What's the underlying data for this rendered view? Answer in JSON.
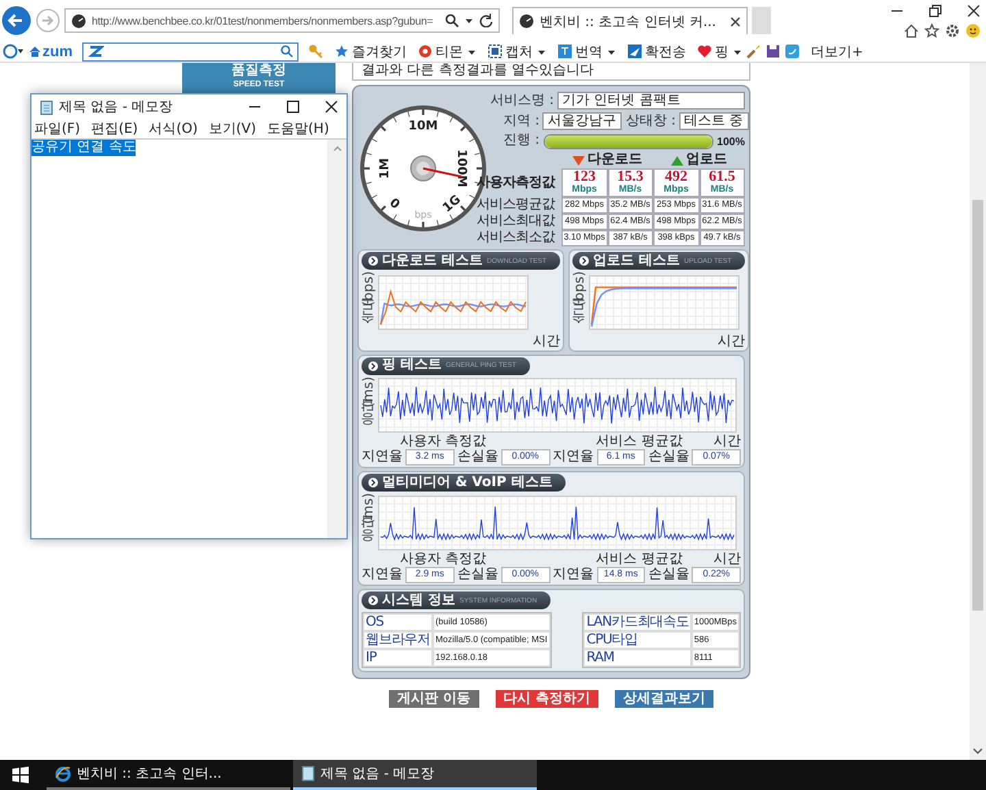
{
  "browser": {
    "url": "http://www.benchbee.co.kr/01test/nonmembers/nonmembers.asp?gubun=",
    "tab_title": "벤치비 :: 초고속 인터넷 커...",
    "toolbar": {
      "logo": "zum",
      "items": [
        {
          "kind": "star",
          "label": "즐겨찾기",
          "caret": false
        },
        {
          "kind": "dot",
          "label": "티몬",
          "caret": true
        },
        {
          "kind": "capture",
          "label": "캡처",
          "caret": true
        },
        {
          "kind": "translate",
          "label": "번역",
          "caret": true
        },
        {
          "kind": "send",
          "label": "확전송",
          "caret": false
        },
        {
          "kind": "heart",
          "label": "핑",
          "caret": true
        },
        {
          "kind": "tools",
          "label": "더보기+",
          "caret": false
        }
      ]
    }
  },
  "banner": {
    "title": "품질측정",
    "subtitle": "SPEED TEST"
  },
  "notice": "결과와 다른 측정결과를 열수있습니다",
  "gauge": {
    "labels": [
      "0",
      "1M",
      "10M",
      "100M",
      "1G"
    ],
    "unit": "bps"
  },
  "info": {
    "service": {
      "label": "서비스명 :",
      "value": "기가 인터넷 콤팩트"
    },
    "region": {
      "label": "지역 :",
      "value": "서울강남구"
    },
    "status": {
      "label": "상태창 :",
      "value": "테스트 중"
    },
    "progress": {
      "label": "진행 :",
      "level": 1,
      "reading": "100%"
    }
  },
  "results": {
    "groups": [
      {
        "kind": "download",
        "label": "다운로드"
      },
      {
        "kind": "upload",
        "label": "업로드"
      }
    ],
    "rows": [
      {
        "kind": "main",
        "label": "사용자측정값",
        "cells": [
          {
            "value": "123",
            "unit": "Mbps"
          },
          {
            "value": "15.3",
            "unit": "MB/s"
          },
          {
            "value": "492",
            "unit": "Mbps"
          },
          {
            "value": "61.5",
            "unit": "MB/s"
          }
        ]
      },
      {
        "kind": "plain",
        "label": "서비스평균값",
        "cells": [
          "282 Mbps",
          "35.2 MB/s",
          "253 Mbps",
          "31.6 MB/s"
        ]
      },
      {
        "kind": "plain",
        "label": "서비스최대값",
        "cells": [
          "498 Mbps",
          "62.4 MB/s",
          "498 Mbps",
          "62.2 MB/s"
        ]
      },
      {
        "kind": "plain",
        "label": "서비스최소값",
        "cells": [
          "3.10 Mbps",
          "387 kB/s",
          "398 kBps",
          "49.7 kB/s"
        ]
      }
    ]
  },
  "throughput": [
    {
      "kind": "download",
      "title": "다운로드 테스트",
      "subtitle": "DOWNLOAD TEST",
      "ylabel": "속도(bps)",
      "xlabel": "시간"
    },
    {
      "kind": "upload",
      "title": "업로드 테스트",
      "subtitle": "UPLOAD TEST",
      "ylabel": "속도(bps)",
      "xlabel": "시간"
    }
  ],
  "latency": [
    {
      "kind": "ping",
      "title": "핑 테스트",
      "subtitle": "GENERAL PING TEST",
      "ylabel": "응답(ms)",
      "xlabel": "시간",
      "user_label": "사용자 측정값",
      "service_label": "서비스 평균값",
      "stats": [
        {
          "label": "지연율",
          "value": "3.2 ms"
        },
        {
          "label": "손실율",
          "value": "0.00%"
        },
        {
          "label": "지연율",
          "value": "6.1 ms"
        },
        {
          "label": "손실율",
          "value": "0.07%"
        }
      ]
    },
    {
      "kind": "voip",
      "title": "멀티미디어 & VoIP 테스트",
      "ylabel": "응답(ms)",
      "xlabel": "시간",
      "user_label": "사용자 측정값",
      "service_label": "서비스 평균값",
      "stats": [
        {
          "label": "지연율",
          "value": "2.9 ms"
        },
        {
          "label": "손실율",
          "value": "0.00%"
        },
        {
          "label": "지연율",
          "value": "14.8 ms"
        },
        {
          "label": "손실율",
          "value": "0.22%"
        }
      ]
    }
  ],
  "system": {
    "title": "시스템 정보",
    "subtitle": "SYSTEM INFORMATION",
    "left": [
      {
        "label": "OS",
        "value": "(build 10586)"
      },
      {
        "label": "웹브라우저",
        "value": "Mozilla/5.0 (compatible; MSI"
      },
      {
        "label": "IP",
        "value": "192.168.0.18"
      }
    ],
    "right": [
      {
        "label": "LAN카드최대속도",
        "value": "1000MBps"
      },
      {
        "label": "CPU타입",
        "value": "586"
      },
      {
        "label": "RAM",
        "value": "8111"
      }
    ]
  },
  "buttons": [
    {
      "kind": "gray",
      "label": "게시판 이동"
    },
    {
      "kind": "red",
      "label": "다시 측정하기"
    },
    {
      "kind": "blue",
      "label": "상세결과보기"
    }
  ],
  "taskbar": {
    "items": [
      {
        "kind": "browser",
        "label": "벤치비 :: 초고속 인터...",
        "selected": false
      },
      {
        "kind": "notepad",
        "label": "제목 없음 - 메모장",
        "selected": true
      }
    ]
  },
  "notepad": {
    "title": "제목 없음 - 메모장",
    "menu": [
      "파일(F)",
      "편집(E)",
      "서식(O)",
      "보기(V)",
      "도움말(H)"
    ],
    "text": "공유기 연결 속도",
    "text_selected": true
  }
}
